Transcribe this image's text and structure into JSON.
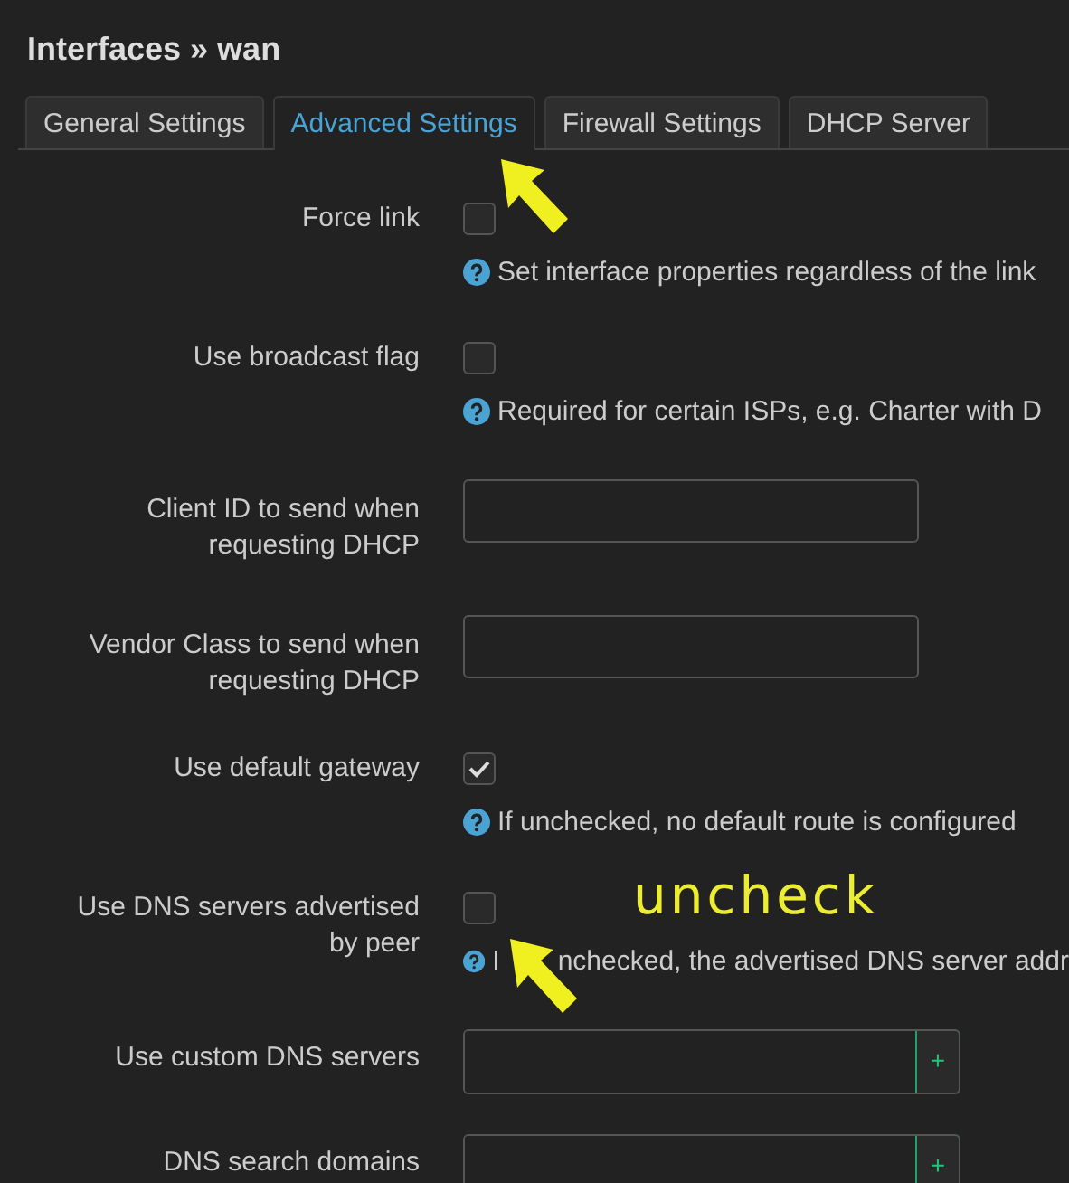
{
  "title": "Interfaces » wan",
  "tabs": [
    {
      "label": "General Settings",
      "selected": false
    },
    {
      "label": "Advanced Settings",
      "selected": true
    },
    {
      "label": "Firewall Settings",
      "selected": false
    },
    {
      "label": "DHCP Server",
      "selected": false
    }
  ],
  "fields": [
    {
      "kind": "checkbox",
      "label": "Force link",
      "checked": false,
      "help": "Set interface properties regardless of the link"
    },
    {
      "kind": "checkbox",
      "label": "Use broadcast flag",
      "checked": false,
      "help": "Required for certain ISPs, e.g. Charter with D"
    },
    {
      "kind": "text",
      "label": "Client ID to send when requesting DHCP"
    },
    {
      "kind": "text",
      "label": "Vendor Class to send when requesting DHCP"
    },
    {
      "kind": "checkbox",
      "label": "Use default gateway",
      "checked": true,
      "help": "If unchecked, no default route is configured"
    },
    {
      "kind": "checkbox",
      "label": "Use DNS servers advertised by peer",
      "checked": false,
      "help": "I",
      "help_rest": "nchecked, the advertised DNS server addr"
    },
    {
      "kind": "dynlist",
      "label": "Use custom DNS servers",
      "button": "+"
    },
    {
      "kind": "dynlist",
      "label": "DNS search domains",
      "button": "+"
    }
  ],
  "annotation": {
    "text": "uncheck"
  }
}
